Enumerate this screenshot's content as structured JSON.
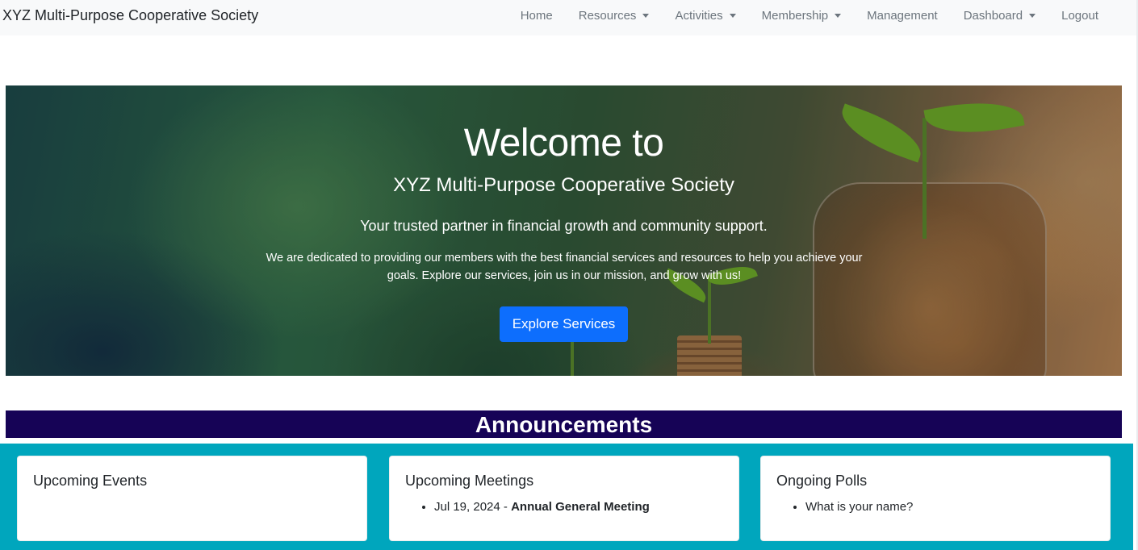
{
  "navbar": {
    "brand": "XYZ Multi-Purpose Cooperative Society",
    "items": [
      {
        "label": "Home",
        "dropdown": false
      },
      {
        "label": "Resources",
        "dropdown": true
      },
      {
        "label": "Activities",
        "dropdown": true
      },
      {
        "label": "Membership",
        "dropdown": true
      },
      {
        "label": "Management",
        "dropdown": false
      },
      {
        "label": "Dashboard",
        "dropdown": true
      },
      {
        "label": "Logout",
        "dropdown": false
      }
    ]
  },
  "hero": {
    "title": "Welcome to",
    "subtitle": "XYZ Multi-Purpose Cooperative Society",
    "lead": "Your trusted partner in financial growth and community support.",
    "description": "We are dedicated to providing our members with the best financial services and resources to help you achieve your goals. Explore our services, join us in our mission, and grow with us!",
    "button_label": "Explore Services"
  },
  "announcements": {
    "heading": "Announcements",
    "cards": [
      {
        "title": "Upcoming Events",
        "items": []
      },
      {
        "title": "Upcoming Meetings",
        "items": [
          {
            "date": "Jul 19, 2024",
            "separator": " - ",
            "name": "Annual General Meeting"
          }
        ]
      },
      {
        "title": "Ongoing Polls",
        "items": [
          {
            "text": "What is your name?"
          }
        ]
      }
    ]
  },
  "colors": {
    "navbar_bg": "#f8f9fa",
    "primary_button": "#0d6efd",
    "announce_bar": "#160356",
    "cards_area": "#00a6bd"
  }
}
